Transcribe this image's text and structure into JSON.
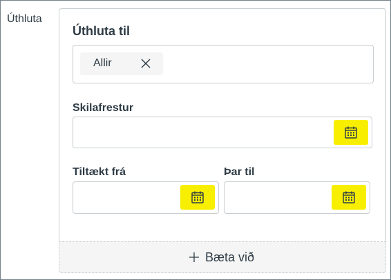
{
  "side_label": "Úthluta",
  "card": {
    "title": "Úthluta til",
    "assign_to": {
      "tags": [
        {
          "label": "Allir"
        }
      ]
    },
    "due": {
      "label": "Skilafrestur",
      "value": ""
    },
    "available_from": {
      "label": "Tiltækt frá",
      "value": ""
    },
    "until": {
      "label": "Þar til",
      "value": ""
    },
    "add_button": {
      "label": "Bæta við"
    }
  },
  "colors": {
    "accent_highlight": "#f8ef00",
    "border": "#c7cdd1",
    "text": "#2d3b45"
  },
  "icons": {
    "remove": "close-icon",
    "calendar": "calendar-icon",
    "add": "plus-icon"
  }
}
